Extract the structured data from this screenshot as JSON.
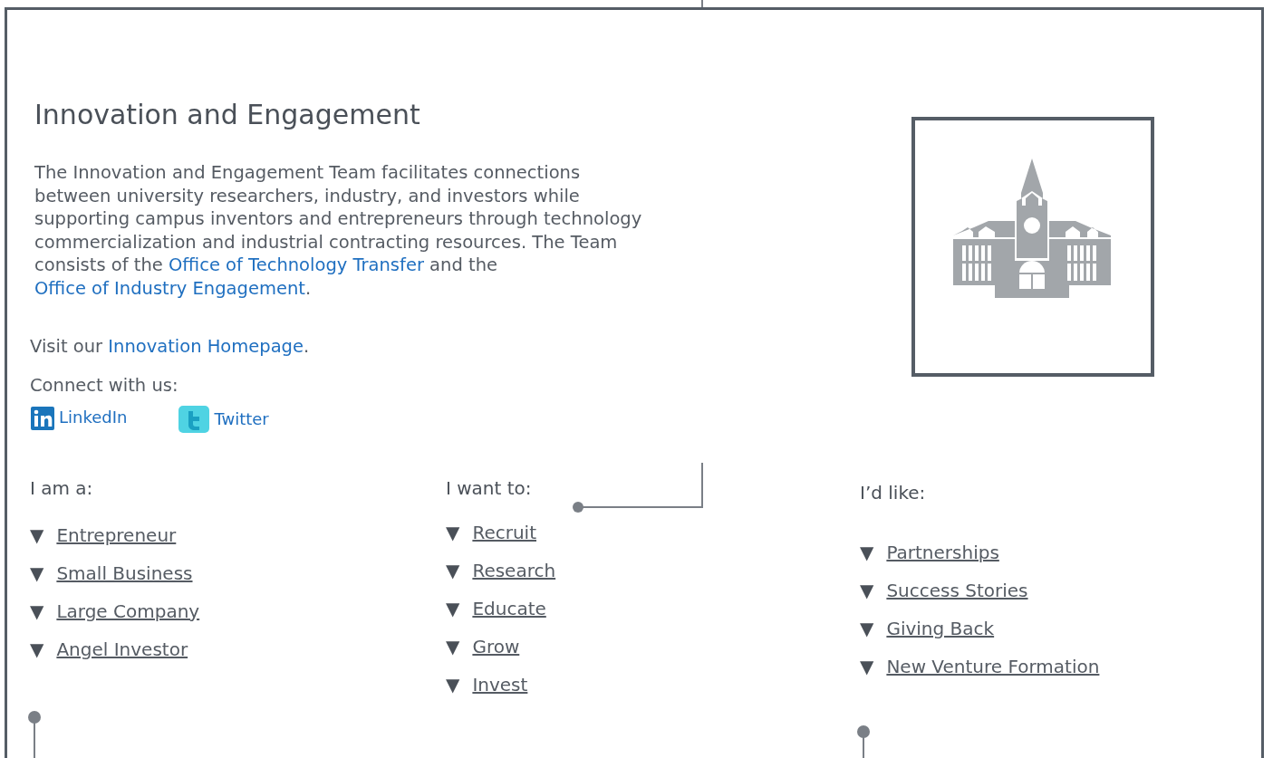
{
  "intro": {
    "title": "Innovation and Engagement",
    "description": "The Innovation and Engagement Team facilitates connections between university researchers, industry, and investors while supporting campus inventors and entrepreneurs through technology commercialization and industrial contracting resources. The Team consists of the ",
    "links": [
      "Office of Technology Transfer",
      "Office of Industry Engagement"
    ],
    "joiner": " and the ",
    "end": ".",
    "visit_prefix": "Visit our ",
    "visit_link": "Innovation Homepage",
    "visit_end": ".",
    "connect_label": "Connect with us:",
    "social": [
      {
        "kind": "linkedin",
        "label": "LinkedIn"
      },
      {
        "kind": "twitter",
        "label": "Twitter"
      }
    ]
  },
  "columns": [
    {
      "heading": "I am a:",
      "items": [
        {
          "marker": "▼",
          "label": "Entrepreneur"
        },
        {
          "marker": "▼",
          "label": "Small Business"
        },
        {
          "marker": "▼",
          "label": "Large Company"
        },
        {
          "marker": "▼",
          "label": "Angel Investor"
        }
      ]
    },
    {
      "heading": "I want to:",
      "items": [
        {
          "marker": "▼",
          "label": "Recruit"
        },
        {
          "marker": "▼",
          "label": "Research"
        },
        {
          "marker": "▼",
          "label": "Educate"
        },
        {
          "marker": "▼",
          "label": "Grow"
        },
        {
          "marker": "▼",
          "label": "Invest"
        }
      ]
    },
    {
      "heading": "I’d like:",
      "items": [
        {
          "marker": "▼",
          "label": "Partnerships"
        },
        {
          "marker": "▼",
          "label": "Success Stories"
        },
        {
          "marker": "▼",
          "label": "Giving Back"
        },
        {
          "marker": "▼",
          "label": "New Venture Formation"
        }
      ]
    }
  ]
}
